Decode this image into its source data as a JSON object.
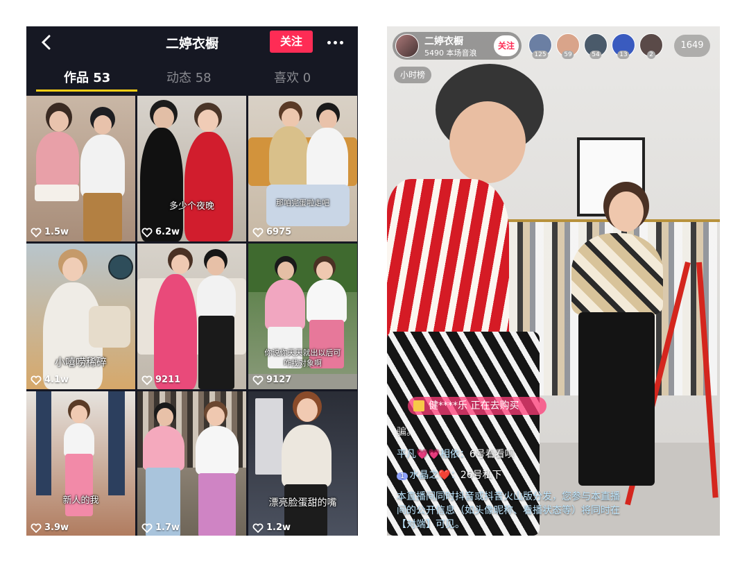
{
  "profile": {
    "title": "二婷衣橱",
    "follow_label": "关注",
    "tabs": [
      {
        "label": "作品 53"
      },
      {
        "label": "动态 58"
      },
      {
        "label": "喜欢 0"
      }
    ],
    "videos": [
      {
        "likes": "1.5w",
        "caption": ""
      },
      {
        "likes": "6.2w",
        "caption": "多少个夜晚"
      },
      {
        "likes": "6975",
        "caption": "那咱完蛋啦走吧"
      },
      {
        "likes": "4.1w",
        "caption": "小嘻唠稀碎"
      },
      {
        "likes": "9211",
        "caption": ""
      },
      {
        "likes": "9127",
        "caption": "你说你天天就出以后可咋找对象啊"
      },
      {
        "likes": "3.9w",
        "caption": "新人的我"
      },
      {
        "likes": "1.7w",
        "caption": ""
      },
      {
        "likes": "1.2w",
        "caption": "漂亮脸蛋甜的嘴"
      }
    ]
  },
  "live": {
    "host_name": "二婷衣橱",
    "host_sub": "5490 本场音浪",
    "follow_label": "关注",
    "viewers": [
      {
        "count": "125",
        "color": "#6b7fa3"
      },
      {
        "count": "59",
        "color": "#d9a48a"
      },
      {
        "count": "54",
        "color": "#4a5a6a"
      },
      {
        "count": "13",
        "color": "#3a5bbf"
      },
      {
        "count": "2",
        "color": "#5a4a48"
      }
    ],
    "viewer_total": "1649",
    "hourly_label": "小时榜",
    "buying_text": "健****乐 正在去购买",
    "faded_text": "骗。",
    "comments": [
      {
        "user": "平凡💗💗相依：",
        "text": "6号看看呗"
      },
      {
        "level": "1",
        "user": "水晶之❤️：",
        "text": "26号私下"
      }
    ],
    "notice": "本直播间同时抖音或抖音火山版分发，您参与本直播间的公开信息（如头像昵称、看播状态等）将同时在【对端】可见。"
  }
}
